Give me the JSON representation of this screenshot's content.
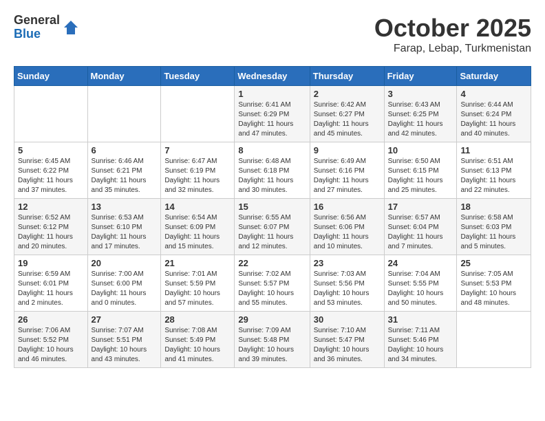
{
  "header": {
    "logo_general": "General",
    "logo_blue": "Blue",
    "month": "October 2025",
    "location": "Farap, Lebap, Turkmenistan"
  },
  "days_of_week": [
    "Sunday",
    "Monday",
    "Tuesday",
    "Wednesday",
    "Thursday",
    "Friday",
    "Saturday"
  ],
  "weeks": [
    [
      {
        "day": "",
        "info": ""
      },
      {
        "day": "",
        "info": ""
      },
      {
        "day": "",
        "info": ""
      },
      {
        "day": "1",
        "info": "Sunrise: 6:41 AM\nSunset: 6:29 PM\nDaylight: 11 hours\nand 47 minutes."
      },
      {
        "day": "2",
        "info": "Sunrise: 6:42 AM\nSunset: 6:27 PM\nDaylight: 11 hours\nand 45 minutes."
      },
      {
        "day": "3",
        "info": "Sunrise: 6:43 AM\nSunset: 6:25 PM\nDaylight: 11 hours\nand 42 minutes."
      },
      {
        "day": "4",
        "info": "Sunrise: 6:44 AM\nSunset: 6:24 PM\nDaylight: 11 hours\nand 40 minutes."
      }
    ],
    [
      {
        "day": "5",
        "info": "Sunrise: 6:45 AM\nSunset: 6:22 PM\nDaylight: 11 hours\nand 37 minutes."
      },
      {
        "day": "6",
        "info": "Sunrise: 6:46 AM\nSunset: 6:21 PM\nDaylight: 11 hours\nand 35 minutes."
      },
      {
        "day": "7",
        "info": "Sunrise: 6:47 AM\nSunset: 6:19 PM\nDaylight: 11 hours\nand 32 minutes."
      },
      {
        "day": "8",
        "info": "Sunrise: 6:48 AM\nSunset: 6:18 PM\nDaylight: 11 hours\nand 30 minutes."
      },
      {
        "day": "9",
        "info": "Sunrise: 6:49 AM\nSunset: 6:16 PM\nDaylight: 11 hours\nand 27 minutes."
      },
      {
        "day": "10",
        "info": "Sunrise: 6:50 AM\nSunset: 6:15 PM\nDaylight: 11 hours\nand 25 minutes."
      },
      {
        "day": "11",
        "info": "Sunrise: 6:51 AM\nSunset: 6:13 PM\nDaylight: 11 hours\nand 22 minutes."
      }
    ],
    [
      {
        "day": "12",
        "info": "Sunrise: 6:52 AM\nSunset: 6:12 PM\nDaylight: 11 hours\nand 20 minutes."
      },
      {
        "day": "13",
        "info": "Sunrise: 6:53 AM\nSunset: 6:10 PM\nDaylight: 11 hours\nand 17 minutes."
      },
      {
        "day": "14",
        "info": "Sunrise: 6:54 AM\nSunset: 6:09 PM\nDaylight: 11 hours\nand 15 minutes."
      },
      {
        "day": "15",
        "info": "Sunrise: 6:55 AM\nSunset: 6:07 PM\nDaylight: 11 hours\nand 12 minutes."
      },
      {
        "day": "16",
        "info": "Sunrise: 6:56 AM\nSunset: 6:06 PM\nDaylight: 11 hours\nand 10 minutes."
      },
      {
        "day": "17",
        "info": "Sunrise: 6:57 AM\nSunset: 6:04 PM\nDaylight: 11 hours\nand 7 minutes."
      },
      {
        "day": "18",
        "info": "Sunrise: 6:58 AM\nSunset: 6:03 PM\nDaylight: 11 hours\nand 5 minutes."
      }
    ],
    [
      {
        "day": "19",
        "info": "Sunrise: 6:59 AM\nSunset: 6:01 PM\nDaylight: 11 hours\nand 2 minutes."
      },
      {
        "day": "20",
        "info": "Sunrise: 7:00 AM\nSunset: 6:00 PM\nDaylight: 11 hours\nand 0 minutes."
      },
      {
        "day": "21",
        "info": "Sunrise: 7:01 AM\nSunset: 5:59 PM\nDaylight: 10 hours\nand 57 minutes."
      },
      {
        "day": "22",
        "info": "Sunrise: 7:02 AM\nSunset: 5:57 PM\nDaylight: 10 hours\nand 55 minutes."
      },
      {
        "day": "23",
        "info": "Sunrise: 7:03 AM\nSunset: 5:56 PM\nDaylight: 10 hours\nand 53 minutes."
      },
      {
        "day": "24",
        "info": "Sunrise: 7:04 AM\nSunset: 5:55 PM\nDaylight: 10 hours\nand 50 minutes."
      },
      {
        "day": "25",
        "info": "Sunrise: 7:05 AM\nSunset: 5:53 PM\nDaylight: 10 hours\nand 48 minutes."
      }
    ],
    [
      {
        "day": "26",
        "info": "Sunrise: 7:06 AM\nSunset: 5:52 PM\nDaylight: 10 hours\nand 46 minutes."
      },
      {
        "day": "27",
        "info": "Sunrise: 7:07 AM\nSunset: 5:51 PM\nDaylight: 10 hours\nand 43 minutes."
      },
      {
        "day": "28",
        "info": "Sunrise: 7:08 AM\nSunset: 5:49 PM\nDaylight: 10 hours\nand 41 minutes."
      },
      {
        "day": "29",
        "info": "Sunrise: 7:09 AM\nSunset: 5:48 PM\nDaylight: 10 hours\nand 39 minutes."
      },
      {
        "day": "30",
        "info": "Sunrise: 7:10 AM\nSunset: 5:47 PM\nDaylight: 10 hours\nand 36 minutes."
      },
      {
        "day": "31",
        "info": "Sunrise: 7:11 AM\nSunset: 5:46 PM\nDaylight: 10 hours\nand 34 minutes."
      },
      {
        "day": "",
        "info": ""
      }
    ]
  ]
}
